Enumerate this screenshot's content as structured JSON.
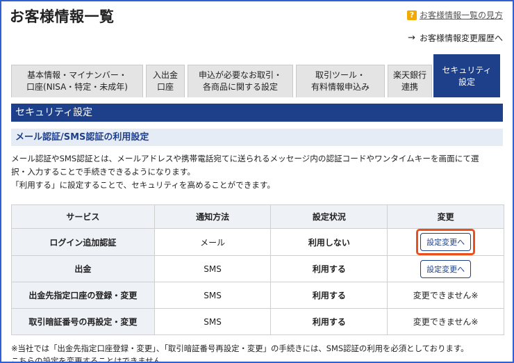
{
  "page": {
    "title": "お客様情報一覧",
    "help_icon": "?",
    "help_link": "お客様情報一覧の見方",
    "history_arrow": "→",
    "history_link": "お客様情報変更履歴へ"
  },
  "tabs": [
    {
      "line1": "基本情報・マイナンバー・",
      "line2": "口座(NISA・特定・未成年)"
    },
    {
      "line1": "入出金",
      "line2": "口座"
    },
    {
      "line1": "申込が必要なお取引・",
      "line2": "各商品に関する設定"
    },
    {
      "line1": "取引ツール・",
      "line2": "有料情報申込み"
    },
    {
      "line1": "楽天銀行",
      "line2": "連携"
    },
    {
      "line1": "セキュリティ",
      "line2": "設定"
    }
  ],
  "section": {
    "title": "セキュリティ設定",
    "subtitle": "メール認証/SMS認証の利用設定",
    "desc1": "メール認証やSMS認証とは、メールアドレスや携帯電話宛てに送られるメッセージ内の認証コードやワンタイムキーを画面にて選",
    "desc2": "択・入力することで手続きできるようになります。",
    "desc3": "「利用する」に設定することで、セキュリティを高めることができます。"
  },
  "table": {
    "headers": [
      "サービス",
      "通知方法",
      "設定状況",
      "変更"
    ],
    "rows": [
      {
        "service": "ログイン追加認証",
        "method": "メール",
        "status": "利用しない",
        "change": "設定変更へ"
      },
      {
        "service": "出金",
        "method": "SMS",
        "status": "利用する",
        "change": "設定変更へ"
      },
      {
        "service": "出金先指定口座の登録・変更",
        "method": "SMS",
        "status": "利用する",
        "change": "変更できません※"
      },
      {
        "service": "取引暗証番号の再設定・変更",
        "method": "SMS",
        "status": "利用する",
        "change": "変更できません※"
      }
    ]
  },
  "note": {
    "line1": "※当社では「出金先指定口座登録・変更」、「取引暗証番号再設定・変更」の手続きには、SMS認証の利用を必須としております。",
    "line2": "こちらの設定を変更することはできません。"
  },
  "colors": {
    "accent": "#1e3f8a",
    "highlight": "#e8501e",
    "help": "#f2a900"
  }
}
